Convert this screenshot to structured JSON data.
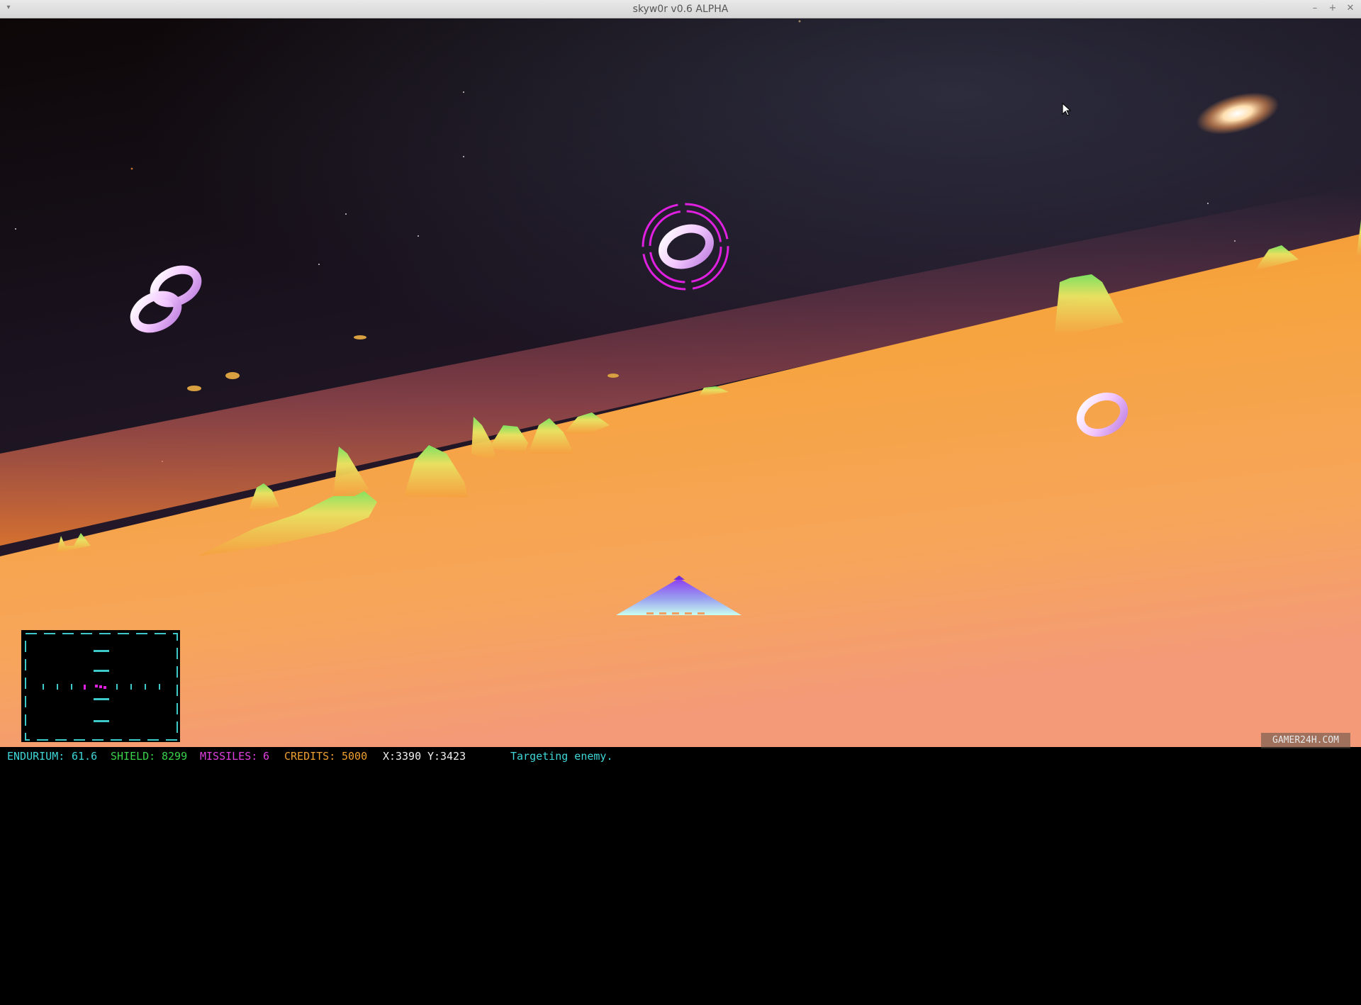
{
  "window": {
    "title": "skyw0r v0.6 ALPHA",
    "menu_icon": "chevron-down-icon",
    "min_glyph": "–",
    "max_glyph": "+",
    "close_glyph": "✕"
  },
  "hud": {
    "endurium_label": "ENDURIUM:",
    "endurium_value": "61.6",
    "shield_label": "SHIELD:",
    "shield_value": "8299",
    "missiles_label": "MISSILES:",
    "missiles_value": "6",
    "credits_label": "CREDITS:",
    "credits_value": "5000",
    "x_label": "X:",
    "x_value": "3390",
    "y_label": "Y:",
    "y_value": "3423",
    "message": "Targeting enemy."
  },
  "watermark": "GAMER24H.COM",
  "colors": {
    "target_reticle": "#e020e0",
    "radar_frame": "#3ec8c8",
    "terrain": "#f6a040",
    "sky": "#1a0f14"
  }
}
